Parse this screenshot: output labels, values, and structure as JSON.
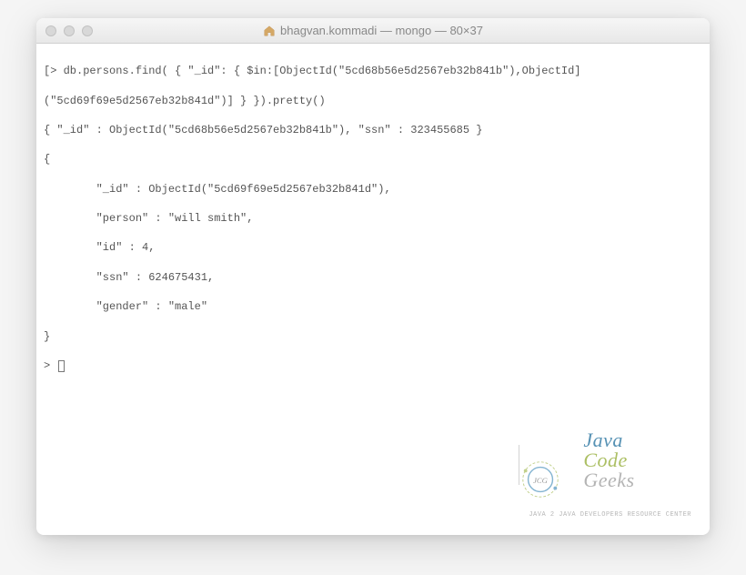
{
  "window": {
    "title": "bhagvan.kommadi — mongo — 80×37"
  },
  "terminal": {
    "lines": [
      "[> db.persons.find( { \"_id\": { $in:[ObjectId(\"5cd68b56e5d2567eb32b841b\"),ObjectId]",
      "(\"5cd69f69e5d2567eb32b841d\")] } }).pretty()",
      "{ \"_id\" : ObjectId(\"5cd68b56e5d2567eb32b841b\"), \"ssn\" : 323455685 }",
      "{",
      "        \"_id\" : ObjectId(\"5cd69f69e5d2567eb32b841d\"),",
      "        \"person\" : \"will smith\",",
      "        \"id\" : 4,",
      "        \"ssn\" : 624675431,",
      "        \"gender\" : \"male\"",
      "}",
      "> "
    ]
  },
  "watermark": {
    "word1": "Java",
    "word2": "Code",
    "word3": "Geeks",
    "subtitle": "Java 2 Java Developers Resource Center",
    "badge": "JCG"
  }
}
